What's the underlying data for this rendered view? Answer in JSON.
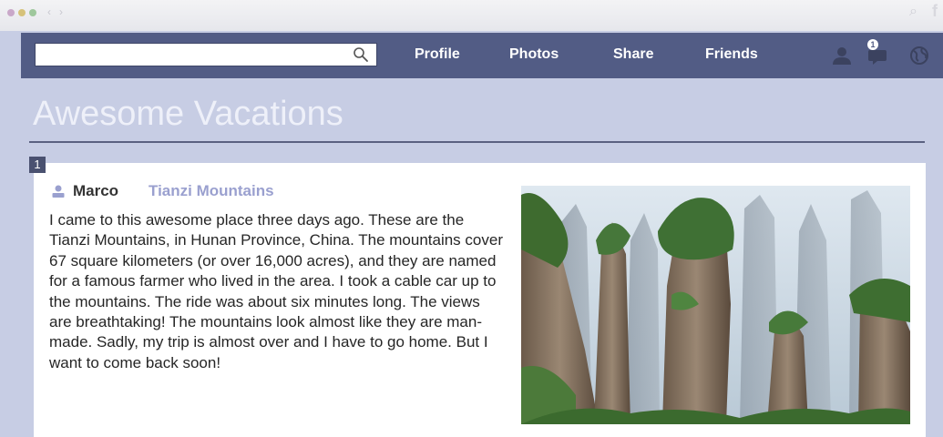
{
  "navbar": {
    "search": {
      "value": "",
      "placeholder": ""
    },
    "links": [
      {
        "label": "Profile"
      },
      {
        "label": "Photos"
      },
      {
        "label": "Share"
      },
      {
        "label": "Friends"
      }
    ],
    "notification_count": "1",
    "icons": [
      "user-icon",
      "chat-icon",
      "globe-icon"
    ]
  },
  "page": {
    "title": "Awesome Vacations"
  },
  "post": {
    "number": "1",
    "author": "Marco",
    "location": "Tianzi Mountains",
    "body": "I came to this awesome place three days ago. These are the Tianzi Mountains, in Hunan Province, China. The mountains cover 67 square kilometers (or over 16,000 acres), and they are named for a famous farmer who lived in the area. I took a cable car up to the mountains. The ride was about six minutes long. The views are breathtaking! The mountains look almost like they are man-made. Sadly, my trip is almost over and I have to go home. But I want to come back soon!",
    "photo_alt": "Tianzi Mountains"
  },
  "colors": {
    "background": "#c7cde4",
    "navbar": "#525c85",
    "accent": "#9aa0cf"
  }
}
